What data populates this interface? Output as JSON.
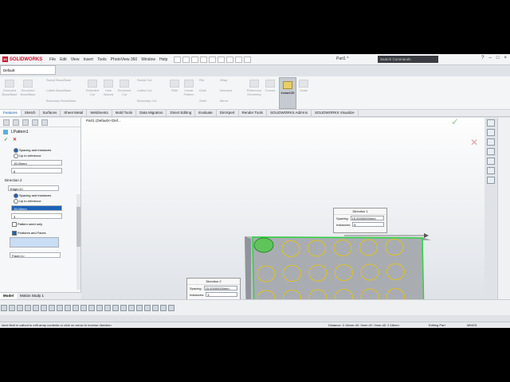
{
  "app": {
    "logo": "SOLIDWORKS",
    "menu": [
      "File",
      "Edit",
      "View",
      "Insert",
      "Tools",
      "PhotoView 360",
      "Window",
      "Help"
    ],
    "doc_title": "Part1 *",
    "search_placeholder": "Search Commands",
    "config": "Default"
  },
  "command_manager": [
    "Extruded Boss/Base",
    "Revolved Boss/Base",
    "Swept Boss/Base",
    "Lofted Boss/Base",
    "Boundary Boss/Base",
    "Extruded Cut",
    "Hole Wizard",
    "Revolved Cut",
    "Swept Cut",
    "Lofted Cut",
    "Boundary Cut",
    "Fillet",
    "Linear Pattern",
    "Rib",
    "Draft",
    "Shell",
    "Wrap",
    "Intersect",
    "Mirror",
    "Reference Geometry",
    "Curves",
    "Instant3D",
    "Scale"
  ],
  "tabs": [
    "Features",
    "Sketch",
    "Surfaces",
    "Sheet Metal",
    "Weldments",
    "Mold Tools",
    "Data Migration",
    "Direct Editing",
    "Evaluate",
    "DimXpert",
    "Render Tools",
    "SOLIDWORKS Add-Ins",
    "SOLIDWORKS Visualize"
  ],
  "left_panel": {
    "title": "LPattern1",
    "dir1": {
      "radio1": "Spacing and instances",
      "radio2": "Up to reference",
      "spacing": "15.00mm",
      "instances": "6"
    },
    "dir2": {
      "header": "Direction 2",
      "edge": "Edge<2>",
      "radio1": "Spacing and instances",
      "radio2": "Up to reference",
      "spacing": "15.00mm",
      "instances": "3",
      "seed_only": "Pattern seed only"
    },
    "features_faces": "Features and Faces",
    "face": "Face<1>"
  },
  "bottom_tabs": [
    "Model",
    "Motion Study 1"
  ],
  "viewport": {
    "tree_root": "Part1  (Default<<Def..."
  },
  "callout1": {
    "title": "Direction 1",
    "spacing_label": "Spacing:",
    "spacing": "15.00000000mm",
    "instances_label": "Instances:",
    "instances": "6"
  },
  "callout2": {
    "title": "Direction 2",
    "spacing_label": "Spacing:",
    "spacing": "15.00000000mm",
    "instances_label": "Instances:",
    "instances": "3"
  },
  "status": {
    "left": "elect field in callout to edit array contents or click on arrow to reverse direction",
    "distance": "Distance: 2.18mm  dX: 0mm  dY: 0mm  dZ: 2.18mm",
    "mode": "Editing Part",
    "units": "MMGS"
  }
}
